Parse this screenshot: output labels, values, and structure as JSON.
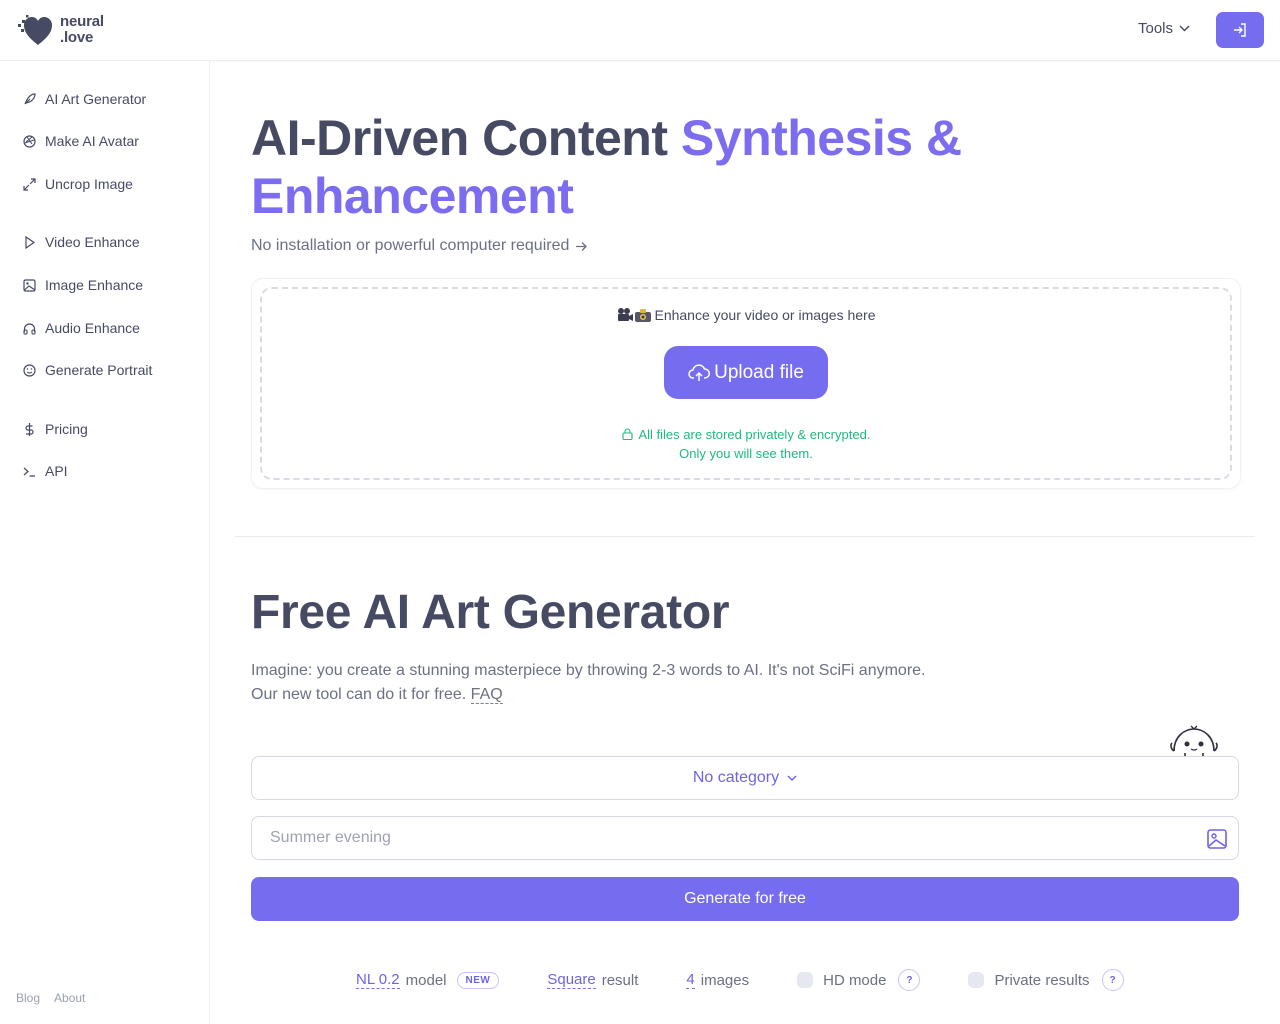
{
  "brand": {
    "line1": "neural",
    "line2": ".love",
    "accent": "#766cf0"
  },
  "header": {
    "tools_label": "Tools"
  },
  "sidebar": {
    "items": [
      {
        "label": "AI Art Generator",
        "icon": "feather-icon"
      },
      {
        "label": "Make AI Avatar",
        "icon": "aperture-icon"
      },
      {
        "label": "Uncrop Image",
        "icon": "expand-icon"
      },
      {
        "label": "Video Enhance",
        "icon": "play-icon"
      },
      {
        "label": "Image Enhance",
        "icon": "image-icon"
      },
      {
        "label": "Audio Enhance",
        "icon": "headphones-icon"
      },
      {
        "label": "Generate Portrait",
        "icon": "smile-icon"
      },
      {
        "label": "Pricing",
        "icon": "dollar-icon"
      },
      {
        "label": "API",
        "icon": "terminal-icon"
      }
    ],
    "footer": {
      "blog": "Blog",
      "about": "About"
    }
  },
  "hero": {
    "title_plain": "AI-Driven Content ",
    "title_accent": "Synthesis & Enhancement",
    "subtitle": "No installation or powerful computer required"
  },
  "upload": {
    "label": "Enhance your video or images here",
    "button": "Upload file",
    "secure_line1": "All files are stored privately & encrypted.",
    "secure_line2": "Only you will see them."
  },
  "art": {
    "title": "Free AI Art Generator",
    "desc_line1": "Imagine: you create a stunning masterpiece by throwing 2-3 words to AI. It's not SciFi anymore.",
    "desc_line2": "Our new tool can do it for free.",
    "faq": "FAQ",
    "category": "No category",
    "prompt_placeholder": "Summer evening",
    "generate": "Generate for free"
  },
  "options": {
    "model_value": "NL 0.2",
    "model_label": "model",
    "model_badge": "NEW",
    "shape_value": "Square",
    "shape_label": "result",
    "count_value": "4",
    "count_label": "images",
    "hd_label": "HD mode",
    "private_label": "Private results",
    "help": "?"
  }
}
